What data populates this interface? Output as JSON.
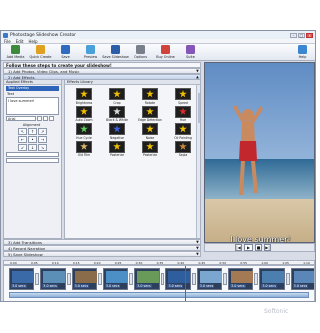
{
  "window": {
    "title": "Photostage Slideshow Creator",
    "minimize": "–",
    "maximize": "□",
    "close": "x"
  },
  "menu": [
    "File",
    "Edit",
    "Help"
  ],
  "toolbar": {
    "add_media": "Add Media",
    "quick_create": "Quick Create",
    "save": "Save",
    "preview": "Preview",
    "save_slideshow": "Save Slideshow",
    "options": "Options",
    "buy_online": "Buy Online",
    "suite": "Suite",
    "help": "Help",
    "icon_colors": {
      "add_media": "#3d8a3d",
      "quick_create": "#e0a020",
      "save": "#2f6bbf",
      "preview": "#4aa0d8",
      "save_slideshow": "#2b5da8",
      "options": "#7a7f8c",
      "buy_online": "#d0433a",
      "suite": "#8456b8",
      "help": "#3a86d0"
    }
  },
  "steps": {
    "header": "Follow these steps to create your slideshow!",
    "items": [
      {
        "label": "1)  Add Photos, Video Clips, and Music",
        "arrow": "▼"
      },
      {
        "label": "2)  Add Effects",
        "arrow": "▲"
      },
      {
        "label": "3)  Add Transitions",
        "arrow": "▼"
      },
      {
        "label": "4)  Record Narration",
        "arrow": "▼"
      },
      {
        "label": "5)  Save Slideshow",
        "arrow": "▼"
      }
    ]
  },
  "applied_effects": {
    "header": "Applied Effects",
    "selected": "Text Overlay",
    "text_label": "Text",
    "text_value": "I love summer!",
    "font": "Arial",
    "alignment_label": "Alignment",
    "alignment_arrows": [
      "↖",
      "↑",
      "↗",
      "←",
      "•",
      "→",
      "↙",
      "↓",
      "↘"
    ]
  },
  "effects_library": {
    "header": "Effects Library",
    "items": [
      {
        "name": "Brightness",
        "color": "#f0c000"
      },
      {
        "name": "Crop",
        "color": "#f0c000"
      },
      {
        "name": "Rotate",
        "color": "#f0c000"
      },
      {
        "name": "Speed",
        "color": "#f0c000"
      },
      {
        "name": "Auto Zoom",
        "color": "#f0c000"
      },
      {
        "name": "Black & White",
        "color": "#dddddd"
      },
      {
        "name": "Edge Detection",
        "color": "#f0c000"
      },
      {
        "name": "Hue",
        "color": "#e02a2a"
      },
      {
        "name": "Hue Cycle",
        "color": "#5ad05a"
      },
      {
        "name": "Negative",
        "color": "#3a5fe0"
      },
      {
        "name": "Noise",
        "color": "#f0c000"
      },
      {
        "name": "Oil Painting",
        "color": "#f0c000"
      },
      {
        "name": "Old Film",
        "color": "#d9b66a"
      },
      {
        "name": "Posterize",
        "color": "#f0c000"
      },
      {
        "name": "Posterize",
        "color": "#f0c000"
      },
      {
        "name": "Sepia",
        "color": "#c98a3a"
      }
    ]
  },
  "preview": {
    "caption": "I love summer!"
  },
  "player": {
    "prev": "|◀",
    "play": "▶",
    "stop": "■",
    "next": "▶|"
  },
  "timeline": {
    "ruler": [
      "0:00",
      "0:05",
      "0:10",
      "0:15",
      "0:20",
      "0:25",
      "0:30",
      "0:35",
      "0:40",
      "0:45",
      "0:50",
      "0:55",
      "1:00",
      "1:05",
      "1:10"
    ],
    "slides": [
      {
        "duration": "3.0 secs",
        "color": "#3a6aa8"
      },
      {
        "duration": "3.0 secs",
        "color": "#5c8fb8"
      },
      {
        "duration": "3.0 secs",
        "color": "#8a6b4a"
      },
      {
        "duration": "3.0 secs",
        "color": "#4c8ec6"
      },
      {
        "duration": "3.0 secs",
        "color": "#6a9a5a"
      },
      {
        "duration": "3.0 secs",
        "color": "#2f5e9e"
      },
      {
        "duration": "3.0 secs",
        "color": "#7aa6cf"
      },
      {
        "duration": "3.0 secs",
        "color": "#a47a54"
      },
      {
        "duration": "3.0 secs",
        "color": "#4a7fb0"
      },
      {
        "duration": "3.0 secs",
        "color": "#5b87b8"
      }
    ]
  },
  "watermark": "Softonic"
}
